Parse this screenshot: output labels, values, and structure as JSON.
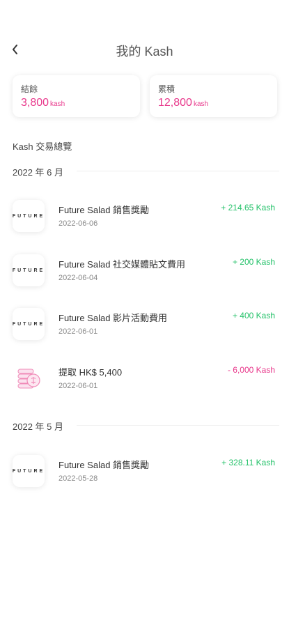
{
  "header": {
    "title": "我的 Kash"
  },
  "summary": {
    "balance_label": "結餘",
    "balance_value": "3,800",
    "balance_unit": "kash",
    "total_label": "累積",
    "total_value": "12,800",
    "total_unit": "kash"
  },
  "overview_title": "Kash 交易總覽",
  "groups": [
    {
      "month": "2022 年 6 月",
      "items": [
        {
          "logo": "FUTURE",
          "name": "Future Salad 銷售獎勵",
          "date": "2022-06-06",
          "amount": "+ 214.65 Kash"
        },
        {
          "logo": "FUTURE",
          "name": "Future Salad 社交媒體貼文費用",
          "date": "2022-06-04",
          "amount": "+ 200 Kash"
        },
        {
          "logo": "FUTURE",
          "name": "Future Salad 影片活動費用",
          "date": "2022-06-01",
          "amount": "+ 400 Kash"
        },
        {
          "logo": "",
          "name": "提取 HK$ 5,400",
          "date": "2022-06-01",
          "amount": "- 6,000 Kash"
        }
      ]
    },
    {
      "month": "2022 年 5 月",
      "items": [
        {
          "logo": "FUTURE",
          "name": "Future Salad 銷售獎勵",
          "date": "2022-05-28",
          "amount": "+ 328.11 Kash"
        }
      ]
    }
  ],
  "colors": {
    "accent": "#e8388b",
    "positive": "#25c26a"
  },
  "icons": {
    "back": "chevron-left-icon",
    "withdraw": "coins-withdraw-icon"
  }
}
